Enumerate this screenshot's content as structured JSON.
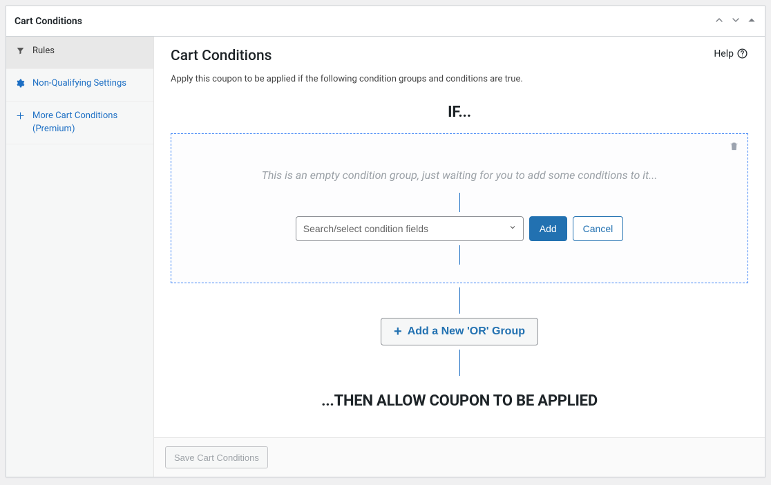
{
  "metabox": {
    "title": "Cart Conditions"
  },
  "sidebar": {
    "items": [
      {
        "label": "Rules"
      },
      {
        "label": "Non-Qualifying Settings"
      },
      {
        "label": "More Cart Conditions (Premium)"
      }
    ]
  },
  "main": {
    "title": "Cart Conditions",
    "help_label": "Help",
    "description": "Apply this coupon to be applied if the following condition groups and conditions are true.",
    "if_label": "IF...",
    "then_label": "...THEN ALLOW COUPON TO BE APPLIED",
    "empty_group_msg": "This is an empty condition group, just waiting for you to add some conditions to it...",
    "select_placeholder": "Search/select condition fields",
    "add_button": "Add",
    "cancel_button": "Cancel",
    "or_group_button": "Add a New 'OR' Group",
    "save_button": "Save Cart Conditions"
  }
}
